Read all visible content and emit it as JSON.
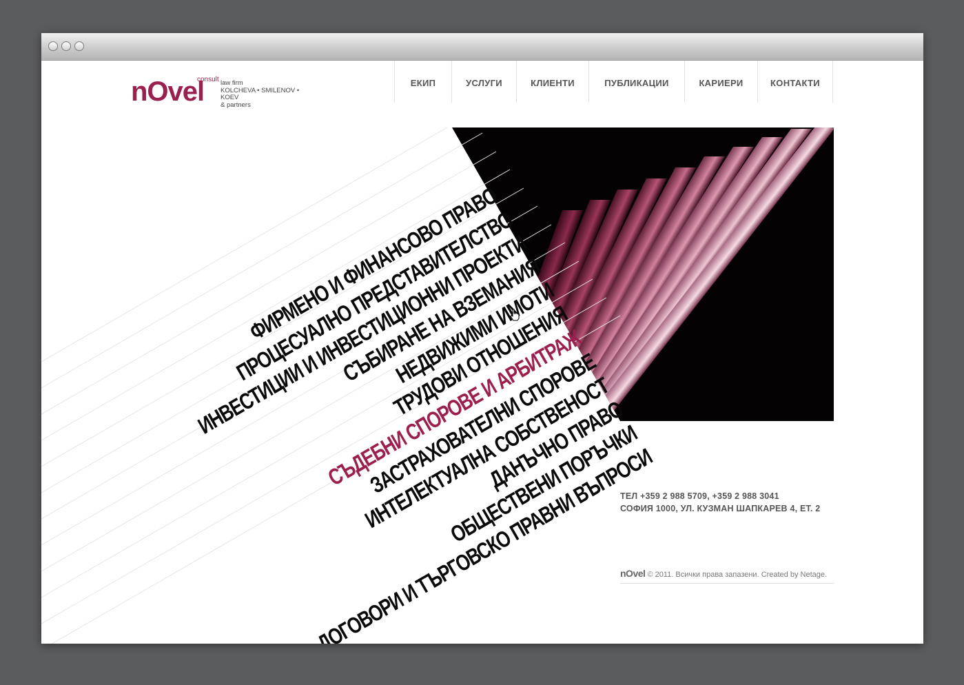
{
  "logo": {
    "mark": "nOvel",
    "consult": "consult",
    "lines": [
      "law firm",
      "KOLCHEVA • SMILENOV • KOEV",
      "& partners"
    ]
  },
  "nav": [
    {
      "label": "ЕКИП"
    },
    {
      "label": "УСЛУГИ"
    },
    {
      "label": "КЛИЕНТИ"
    },
    {
      "label": "ПУБЛИКАЦИИ"
    },
    {
      "label": "КАРИЕРИ"
    },
    {
      "label": "КОНТАКТИ"
    }
  ],
  "services": [
    {
      "label": "ФИРМЕНО И ФИНАНСОВО ПРАВО"
    },
    {
      "label": "ПРОЦЕСУАЛНО ПРЕДСТАВИТЕЛСТВО"
    },
    {
      "label": "ИНВЕСТИЦИИ И ИНВЕСТИЦИОННИ ПРОЕКТИ"
    },
    {
      "label": "СЪБИРАНЕ НА ВЗЕМАНИЯ"
    },
    {
      "label": "НЕДВИЖИМИ ИМОТИ"
    },
    {
      "label": "ТРУДОВИ ОТНОШЕНИЯ"
    },
    {
      "label": "СЪДЕБНИ СПОРОВЕ И АРБИТРАЖ",
      "active": true
    },
    {
      "label": "ЗАСТРАХОВАТЕЛНИ СПОРОВЕ"
    },
    {
      "label": "ИНТЕЛЕКТУАЛНА СОБСТВЕНОСТ"
    },
    {
      "label": "ДАНЪЧНО ПРАВО"
    },
    {
      "label": "ОБЩЕСТВЕНИ ПОРЪЧКИ"
    },
    {
      "label": "ДОГОВОРИ И ТЪРГОВСКО ПРАВНИ ВЪПРОСИ"
    }
  ],
  "contact": {
    "phone": "ТЕЛ +359 2 988 5709, +359 2 988 3041",
    "address": "СОФИЯ 1000, УЛ. КУЗМАН ШАПКАРЕВ 4, ЕТ. 2"
  },
  "footer": {
    "logo": "nOvel",
    "text": "© 2011. Всички права запазени. Created by Netage."
  },
  "colors": {
    "brand": "#9b1f4f",
    "frame": "#5b5c5e",
    "text_dark": "#0a0a0a"
  },
  "icons": {
    "cursor": "hand-pointer-icon"
  }
}
